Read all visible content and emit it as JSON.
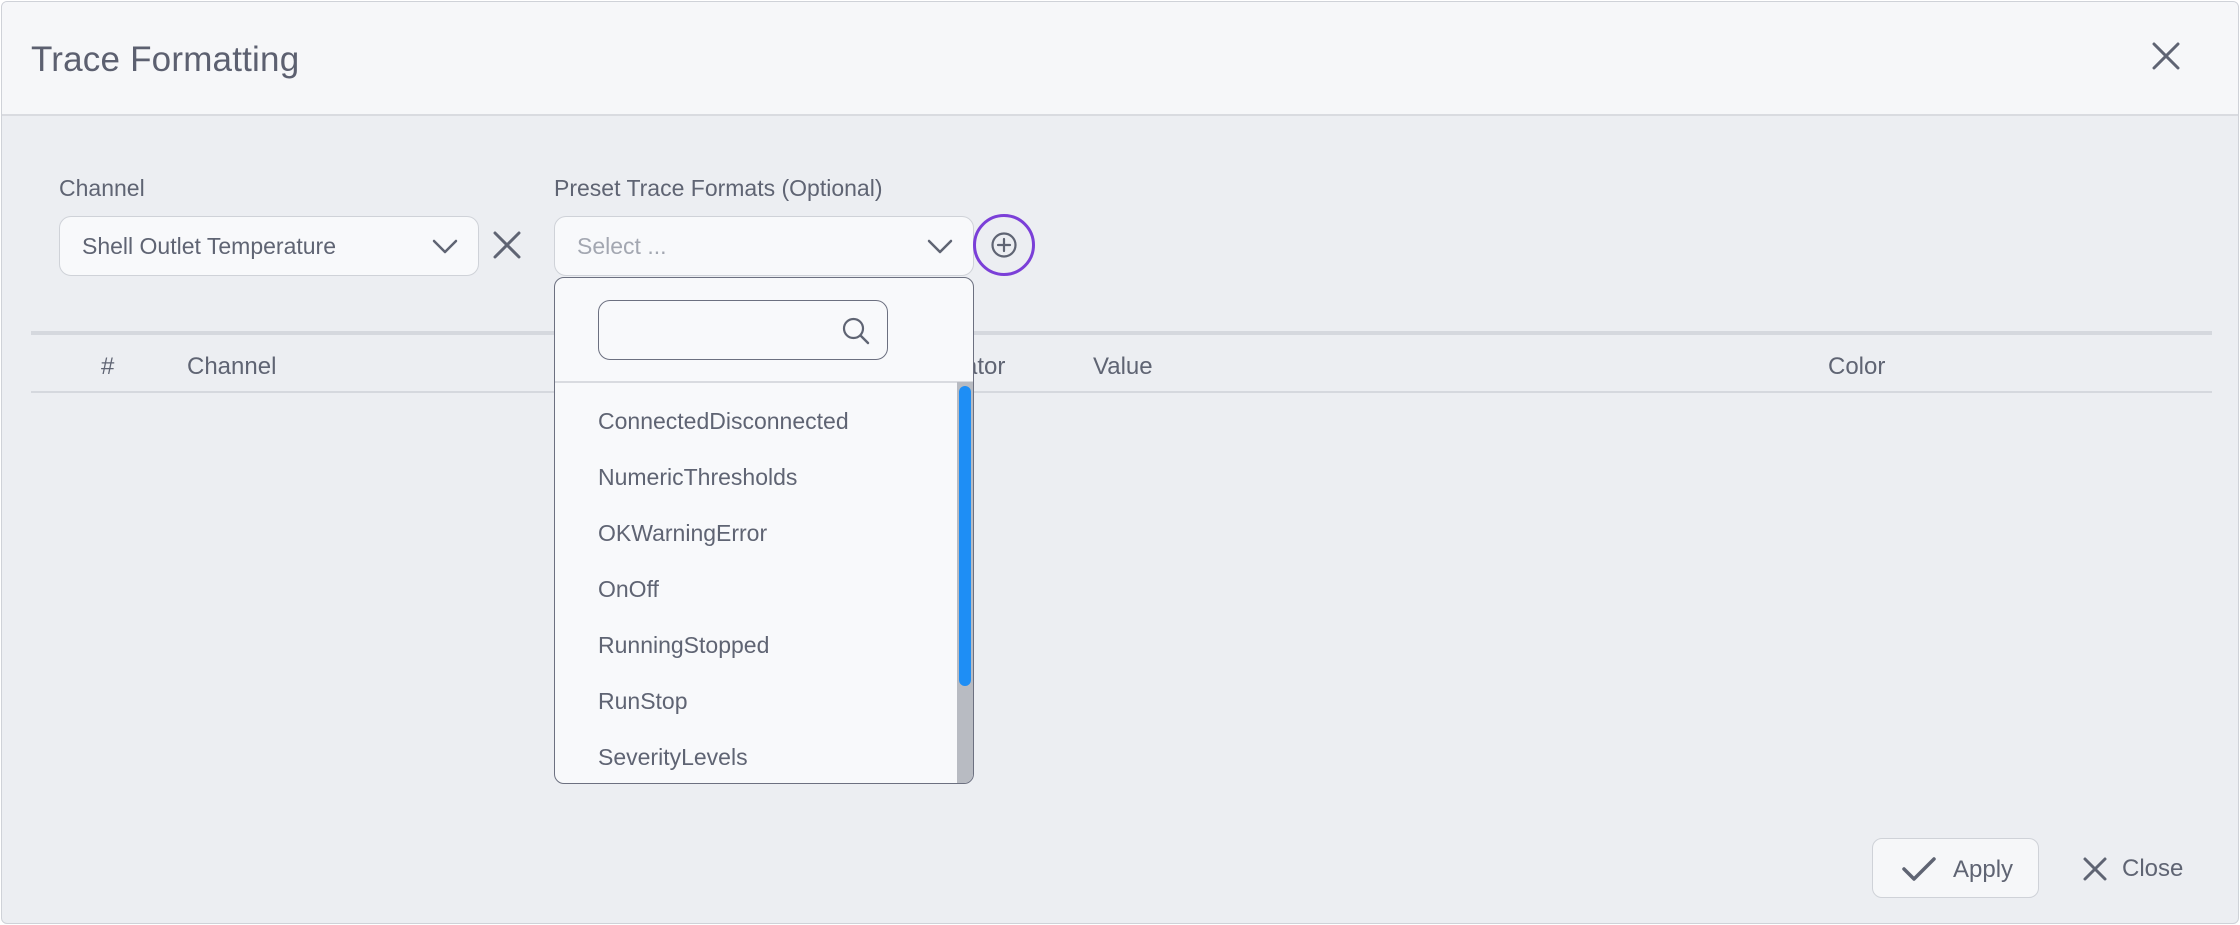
{
  "dialog": {
    "title": "Trace Formatting"
  },
  "channel_field": {
    "label": "Channel",
    "value": "Shell Outlet Temperature"
  },
  "preset_field": {
    "label": "Preset Trace Formats (Optional)",
    "placeholder": "Select ..."
  },
  "dropdown": {
    "search_value": "",
    "options": [
      "ConnectedDisconnected",
      "NumericThresholds",
      "OKWarningError",
      "OnOff",
      "RunningStopped",
      "RunStop",
      "SeverityLevels"
    ]
  },
  "table": {
    "columns": {
      "index": "#",
      "channel": "Channel",
      "operator_partial": "ator",
      "value": "Value",
      "color": "Color"
    }
  },
  "footer": {
    "apply_label": "Apply",
    "close_label": "Close"
  },
  "colors": {
    "accent_focus": "#7b3fd8",
    "scrollbar_thumb": "#1e8ef5"
  }
}
